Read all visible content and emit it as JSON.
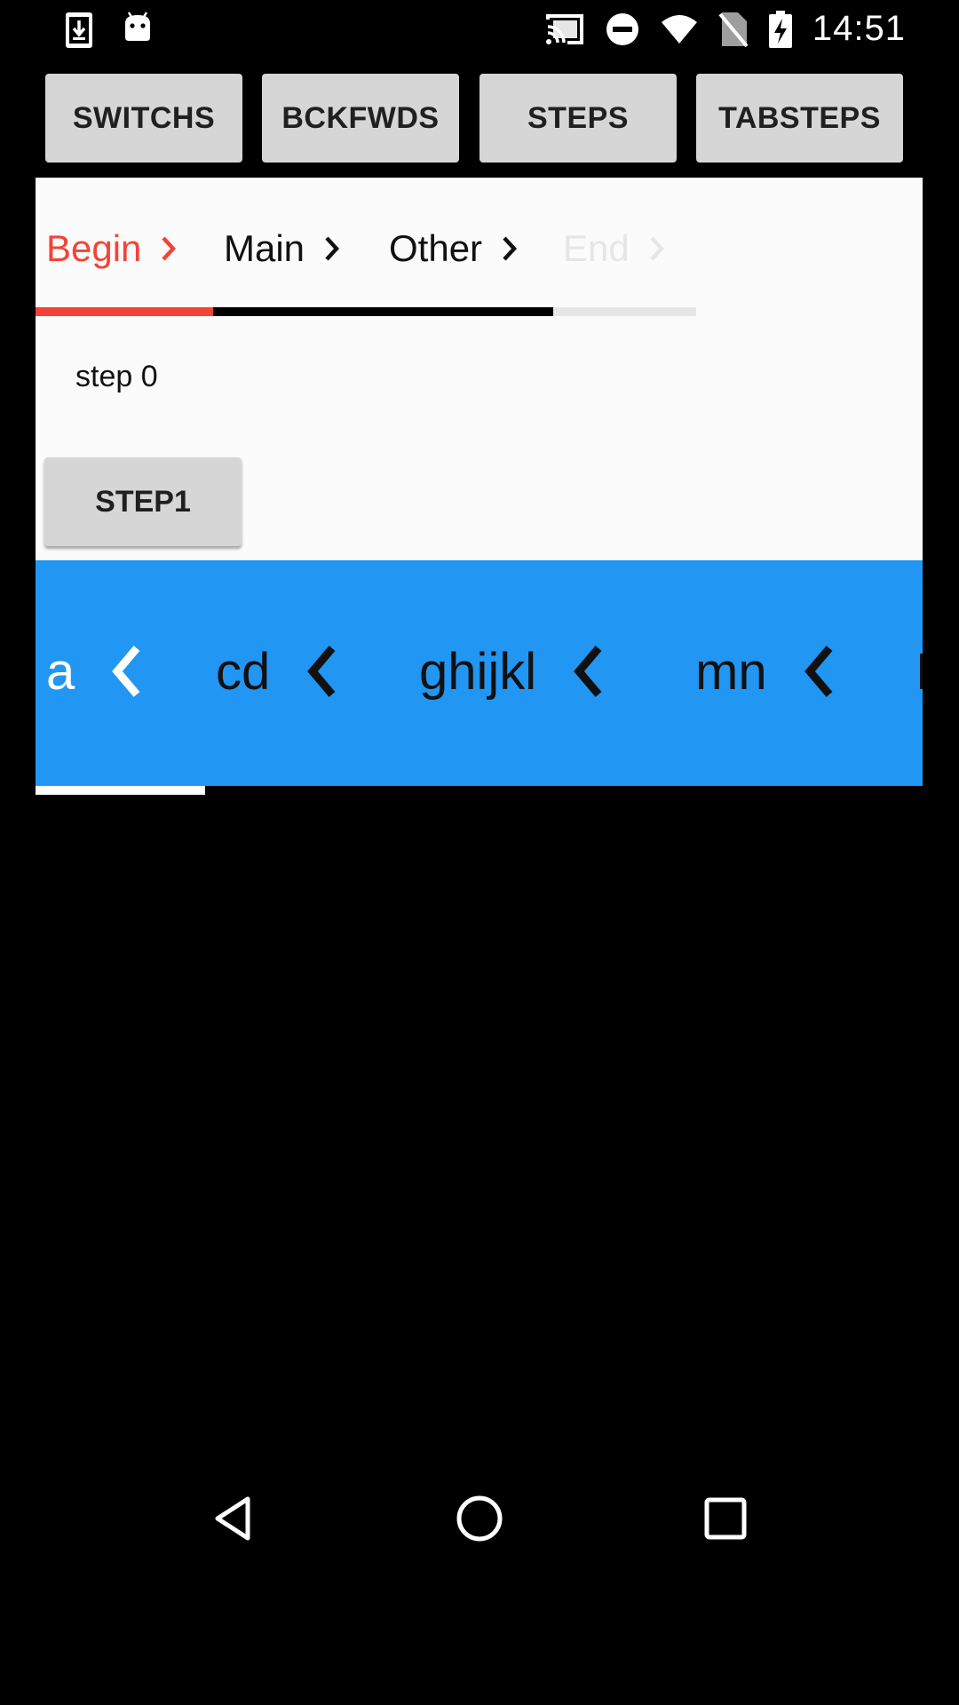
{
  "status_bar": {
    "time": "14:51",
    "icons": [
      "download-icon",
      "android-icon",
      "cast-icon",
      "do-not-disturb-icon",
      "wifi-icon",
      "no-sim-icon",
      "battery-charging-icon"
    ]
  },
  "top_buttons": [
    {
      "label": "SWITCHS"
    },
    {
      "label": "BCKFWDS"
    },
    {
      "label": "STEPS"
    },
    {
      "label": "TABSTEPS"
    }
  ],
  "steps": [
    {
      "label": "Begin",
      "state": "active",
      "color": "#f44336"
    },
    {
      "label": "Main",
      "state": "normal",
      "color": "#111111"
    },
    {
      "label": "Other",
      "state": "normal",
      "color": "#111111"
    },
    {
      "label": "End",
      "state": "disabled",
      "color": "#e6e6e6"
    }
  ],
  "progress_colors": {
    "active": "#f44336",
    "done": "#000000",
    "remaining": "#e6e6e6"
  },
  "step_text": "step 0",
  "step_button": {
    "label": "STEP1"
  },
  "tabs": [
    {
      "label": "a",
      "color": "#ffffff",
      "icon": "chevron-left-icon"
    },
    {
      "label": "cd",
      "color": "#111111",
      "icon": "chevron-left-icon"
    },
    {
      "label": "ghijkl",
      "color": "#111111",
      "icon": "chevron-left-icon"
    },
    {
      "label": "mn",
      "color": "#111111",
      "icon": "chevron-left-icon"
    }
  ],
  "tab_strip_color": "#2196f3",
  "nav_bar": {
    "icons": [
      "back-icon",
      "home-icon",
      "recents-icon"
    ]
  }
}
